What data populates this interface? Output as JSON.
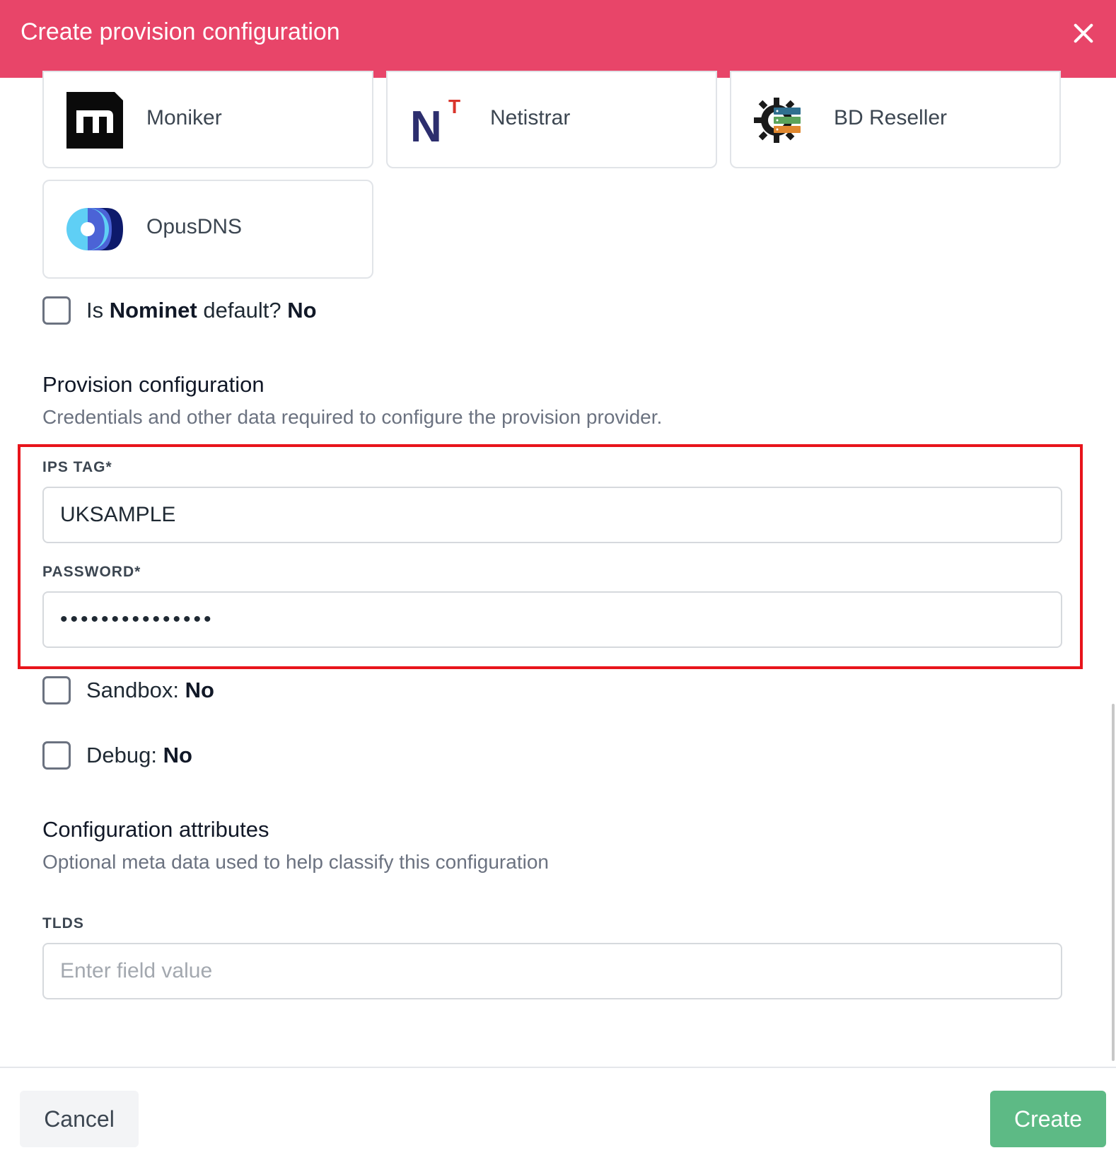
{
  "dialog": {
    "title": "Create provision configuration"
  },
  "providers": [
    {
      "label": "Moniker",
      "icon": "moniker-logo-icon"
    },
    {
      "label": "Netistrar",
      "icon": "netistrar-logo-icon"
    },
    {
      "label": "BD Reseller",
      "icon": "bd-reseller-logo-icon"
    },
    {
      "label": "OpusDNS",
      "icon": "opusdns-logo-icon"
    }
  ],
  "nominet_default": {
    "prefix": "Is ",
    "name": "Nominet",
    "suffix": " default? ",
    "value": "No"
  },
  "provision_section": {
    "title": "Provision configuration",
    "description": "Credentials and other data required to configure the provision provider."
  },
  "fields": {
    "ips_tag": {
      "label": "IPS TAG*",
      "value": "UKSAMPLE"
    },
    "password": {
      "label": "PASSWORD*",
      "value": "•••••••••••••••"
    }
  },
  "sandbox": {
    "label": "Sandbox: ",
    "value": "No"
  },
  "debug": {
    "label": "Debug: ",
    "value": "No"
  },
  "attributes_section": {
    "title": "Configuration attributes",
    "description": "Optional meta data used to help classify this configuration"
  },
  "tlds": {
    "label": "TLDS",
    "placeholder": "Enter field value"
  },
  "footer": {
    "cancel_label": "Cancel",
    "create_label": "Create"
  },
  "colors": {
    "header": "#e84569",
    "create_button": "#5dba85",
    "highlight": "#e8141b"
  }
}
